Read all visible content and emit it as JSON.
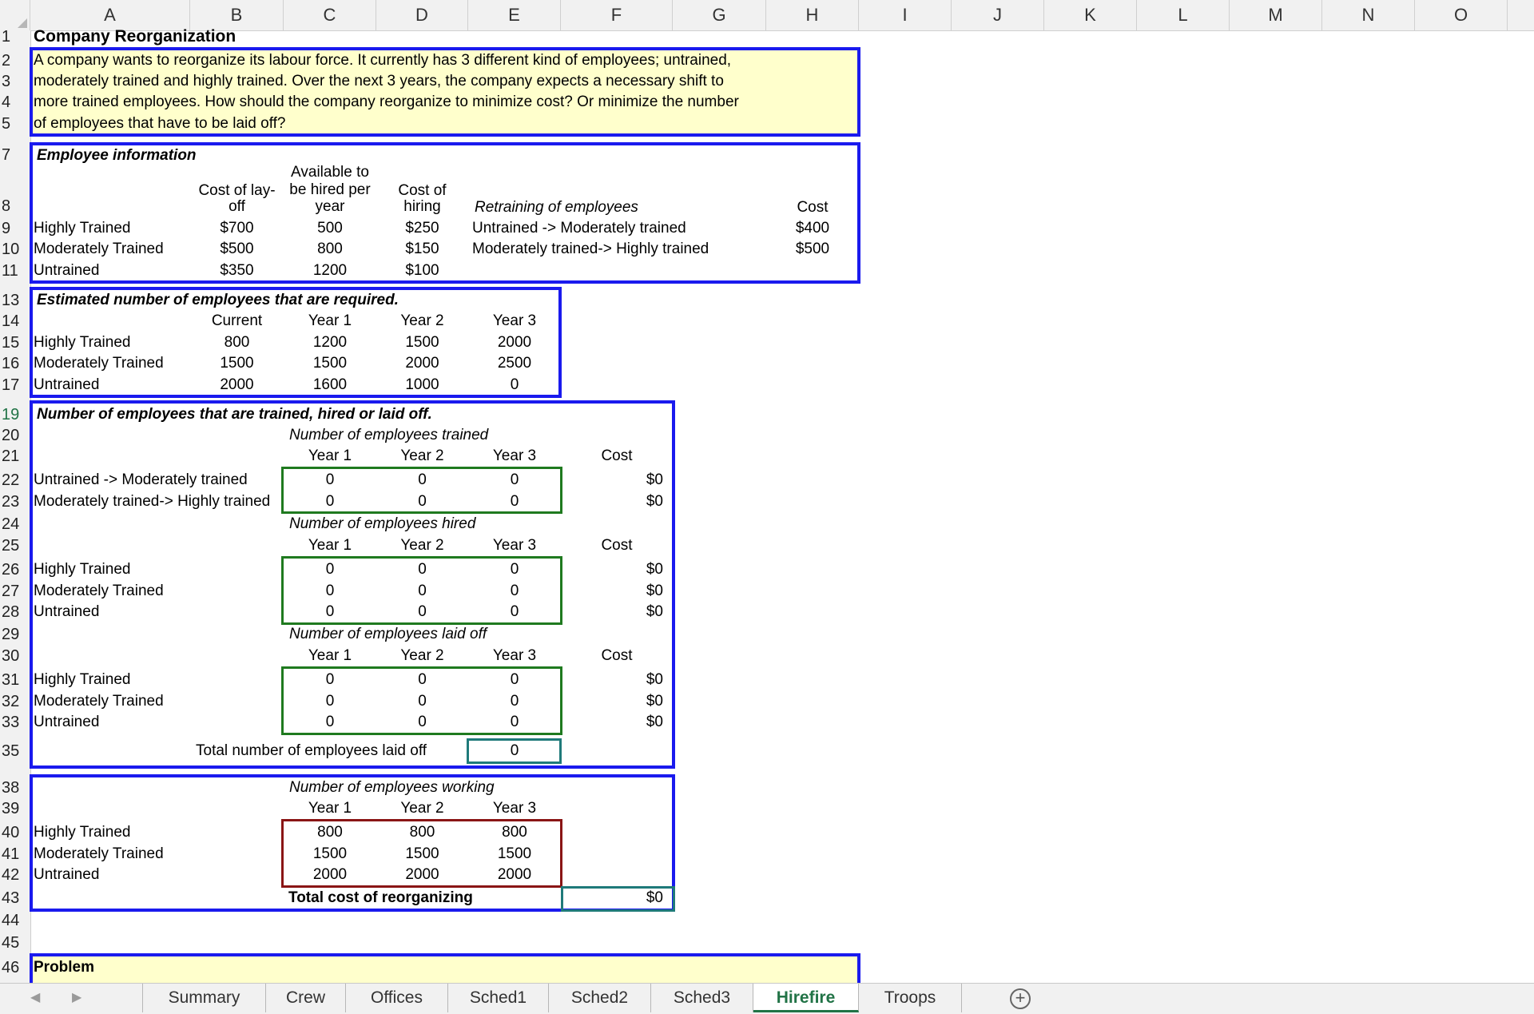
{
  "columns": [
    "A",
    "B",
    "C",
    "D",
    "E",
    "F",
    "G",
    "H",
    "I",
    "J",
    "K",
    "L",
    "M",
    "N",
    "O"
  ],
  "rows": [
    "1",
    "2",
    "3",
    "4",
    "5",
    "7",
    "8",
    "9",
    "10",
    "11",
    "13",
    "14",
    "15",
    "16",
    "17",
    "19",
    "20",
    "21",
    "22",
    "23",
    "24",
    "25",
    "26",
    "27",
    "28",
    "29",
    "30",
    "31",
    "32",
    "33",
    "35",
    "38",
    "39",
    "40",
    "41",
    "42",
    "43",
    "44",
    "45",
    "46"
  ],
  "selected_row": "19",
  "title": "Company Reorganization",
  "intro": [
    "A company wants to reorganize its labour force. It currently has 3 different kind of employees; untrained,",
    "moderately trained and highly trained. Over the next 3 years, the company expects a necessary shift to",
    "more trained employees. How should the company reorganize to minimize cost? Or minimize the number",
    "of employees that have to be laid off?"
  ],
  "employee_info": {
    "heading": "Employee information",
    "col_layoff": [
      "Cost of lay-",
      "off"
    ],
    "col_available": [
      "Available to",
      "be hired per",
      "year"
    ],
    "col_hiring": [
      "Cost of",
      "hiring"
    ],
    "retraining_label": "Retraining of employees",
    "cost_label": "Cost",
    "rows": [
      {
        "label": "Highly Trained",
        "layoff": "$700",
        "available": "500",
        "hiring": "$250"
      },
      {
        "label": "Moderately Trained",
        "layoff": "$500",
        "available": "800",
        "hiring": "$150"
      },
      {
        "label": "Untrained",
        "layoff": "$350",
        "available": "1200",
        "hiring": "$100"
      }
    ],
    "retraining": [
      {
        "label": "Untrained -> Moderately trained",
        "cost": "$400"
      },
      {
        "label": "Moderately trained-> Highly trained",
        "cost": "$500"
      }
    ]
  },
  "required": {
    "heading": "Estimated number of employees that are required.",
    "headers": [
      "Current",
      "Year 1",
      "Year 2",
      "Year 3"
    ],
    "rows": [
      {
        "label": "Highly Trained",
        "values": [
          "800",
          "1200",
          "1500",
          "2000"
        ]
      },
      {
        "label": "Moderately Trained",
        "values": [
          "1500",
          "1500",
          "2000",
          "2500"
        ]
      },
      {
        "label": "Untrained",
        "values": [
          "2000",
          "1600",
          "1000",
          "0"
        ]
      }
    ]
  },
  "actions": {
    "heading": "Number of employees that are trained, hired or laid off.",
    "year_headers": [
      "Year 1",
      "Year 2",
      "Year 3"
    ],
    "cost_label": "Cost",
    "trained": {
      "subheading": "Number of employees trained",
      "rows": [
        {
          "label": "Untrained -> Moderately trained",
          "values": [
            "0",
            "0",
            "0"
          ],
          "cost": "$0"
        },
        {
          "label": "Moderately trained-> Highly trained",
          "values": [
            "0",
            "0",
            "0"
          ],
          "cost": "$0"
        }
      ]
    },
    "hired": {
      "subheading": "Number of employees hired",
      "rows": [
        {
          "label": "Highly Trained",
          "values": [
            "0",
            "0",
            "0"
          ],
          "cost": "$0"
        },
        {
          "label": "Moderately Trained",
          "values": [
            "0",
            "0",
            "0"
          ],
          "cost": "$0"
        },
        {
          "label": "Untrained",
          "values": [
            "0",
            "0",
            "0"
          ],
          "cost": "$0"
        }
      ]
    },
    "laidoff": {
      "subheading": "Number of employees laid off",
      "rows": [
        {
          "label": "Highly Trained",
          "values": [
            "0",
            "0",
            "0"
          ],
          "cost": "$0"
        },
        {
          "label": "Moderately Trained",
          "values": [
            "0",
            "0",
            "0"
          ],
          "cost": "$0"
        },
        {
          "label": "Untrained",
          "values": [
            "0",
            "0",
            "0"
          ],
          "cost": "$0"
        }
      ]
    },
    "total_laidoff_label": "Total number of employees laid off",
    "total_laidoff_value": "0"
  },
  "working": {
    "subheading": "Number of employees working",
    "headers": [
      "Year 1",
      "Year 2",
      "Year 3"
    ],
    "rows": [
      {
        "label": "Highly Trained",
        "values": [
          "800",
          "800",
          "800"
        ]
      },
      {
        "label": "Moderately Trained",
        "values": [
          "1500",
          "1500",
          "1500"
        ]
      },
      {
        "label": "Untrained",
        "values": [
          "2000",
          "2000",
          "2000"
        ]
      }
    ],
    "total_cost_label": "Total cost of reorganizing",
    "total_cost_value": "$0"
  },
  "problem_label": "Problem",
  "sheet_tabs": [
    "Summary",
    "Crew",
    "Offices",
    "Sched1",
    "Sched2",
    "Sched3",
    "Hirefire",
    "Troops"
  ],
  "active_tab": "Hirefire",
  "add_sheet_symbol": "+",
  "nav_prev": "◀",
  "nav_next": "▶"
}
